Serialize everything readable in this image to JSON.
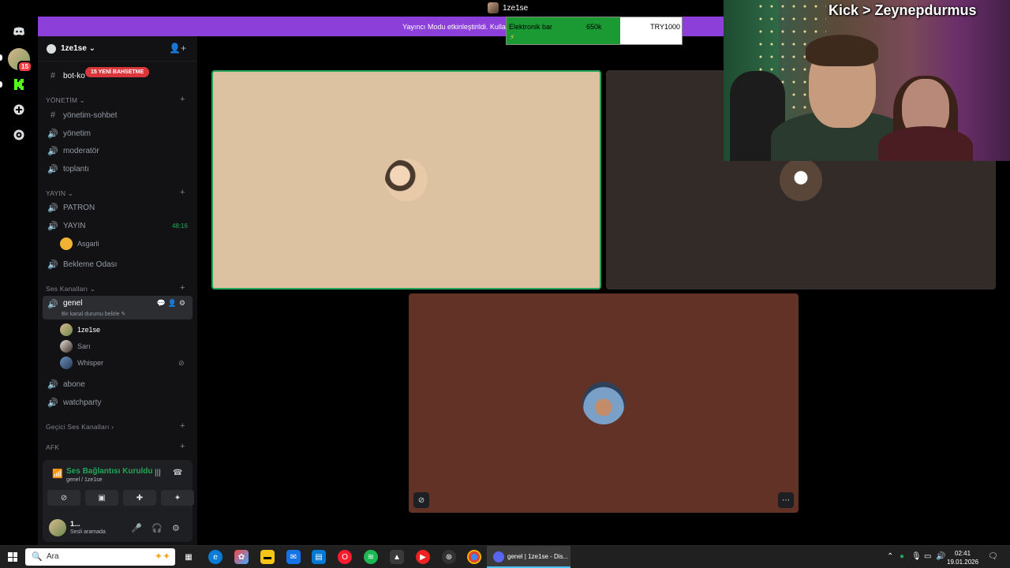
{
  "window": {
    "title": "1ze1se"
  },
  "banner": {
    "text": "Yayıncı Modu etkinleştirildi. Kulla"
  },
  "overlay": {
    "label": "Elektronik bar",
    "amount": "650k",
    "goal": "TRY1000",
    "progress": 0.65,
    "bolt": "⚡"
  },
  "server": {
    "name": "1ze1se"
  },
  "sidebar": {
    "new_badge": "15 YENİ BAHSETME",
    "top_channel": "bot-ko",
    "categories": {
      "yonetim": "YÖNETİM",
      "yayin": "YAYIN",
      "ses": "Ses Kanalları",
      "gecici": "Geçici Ses Kanalları",
      "afk": "AFK"
    },
    "channels": {
      "yonetim_sohbet": "yönetim-sohbet",
      "yonetim": "yönetim",
      "moderator": "moderatör",
      "toplanti": "toplantı",
      "patron": "PATRON",
      "yayin": "YAYIN",
      "yayin_timer": "48:16",
      "asgarli": "Asgarli",
      "bekleme": "Bekleme Odası",
      "genel": "genel",
      "genel_status": "Bir kanal durumu belirle",
      "abone": "abone",
      "watchparty": "watchparty"
    },
    "voice_users": [
      "1ze1se",
      "Sarı",
      "Whisper"
    ]
  },
  "voice_panel": {
    "status": "Ses Bağlantısı Kuruldu",
    "location": "genel / 1ze1se"
  },
  "user_panel": {
    "name": "1...",
    "status": "Sesli aramada"
  },
  "webcam": {
    "overlay_text": "Kick > Zeynepdurmus"
  },
  "taskbar": {
    "search_placeholder": "Ara",
    "active_window": "genel | 1ze1se - Dis...",
    "time": "02:41",
    "date": "19.01.2026"
  },
  "rail": {
    "badge": "15"
  },
  "colors": {
    "accent": "#5865f2",
    "online": "#23a55a",
    "banner": "#8c3fd9",
    "mention": "#da373c"
  }
}
